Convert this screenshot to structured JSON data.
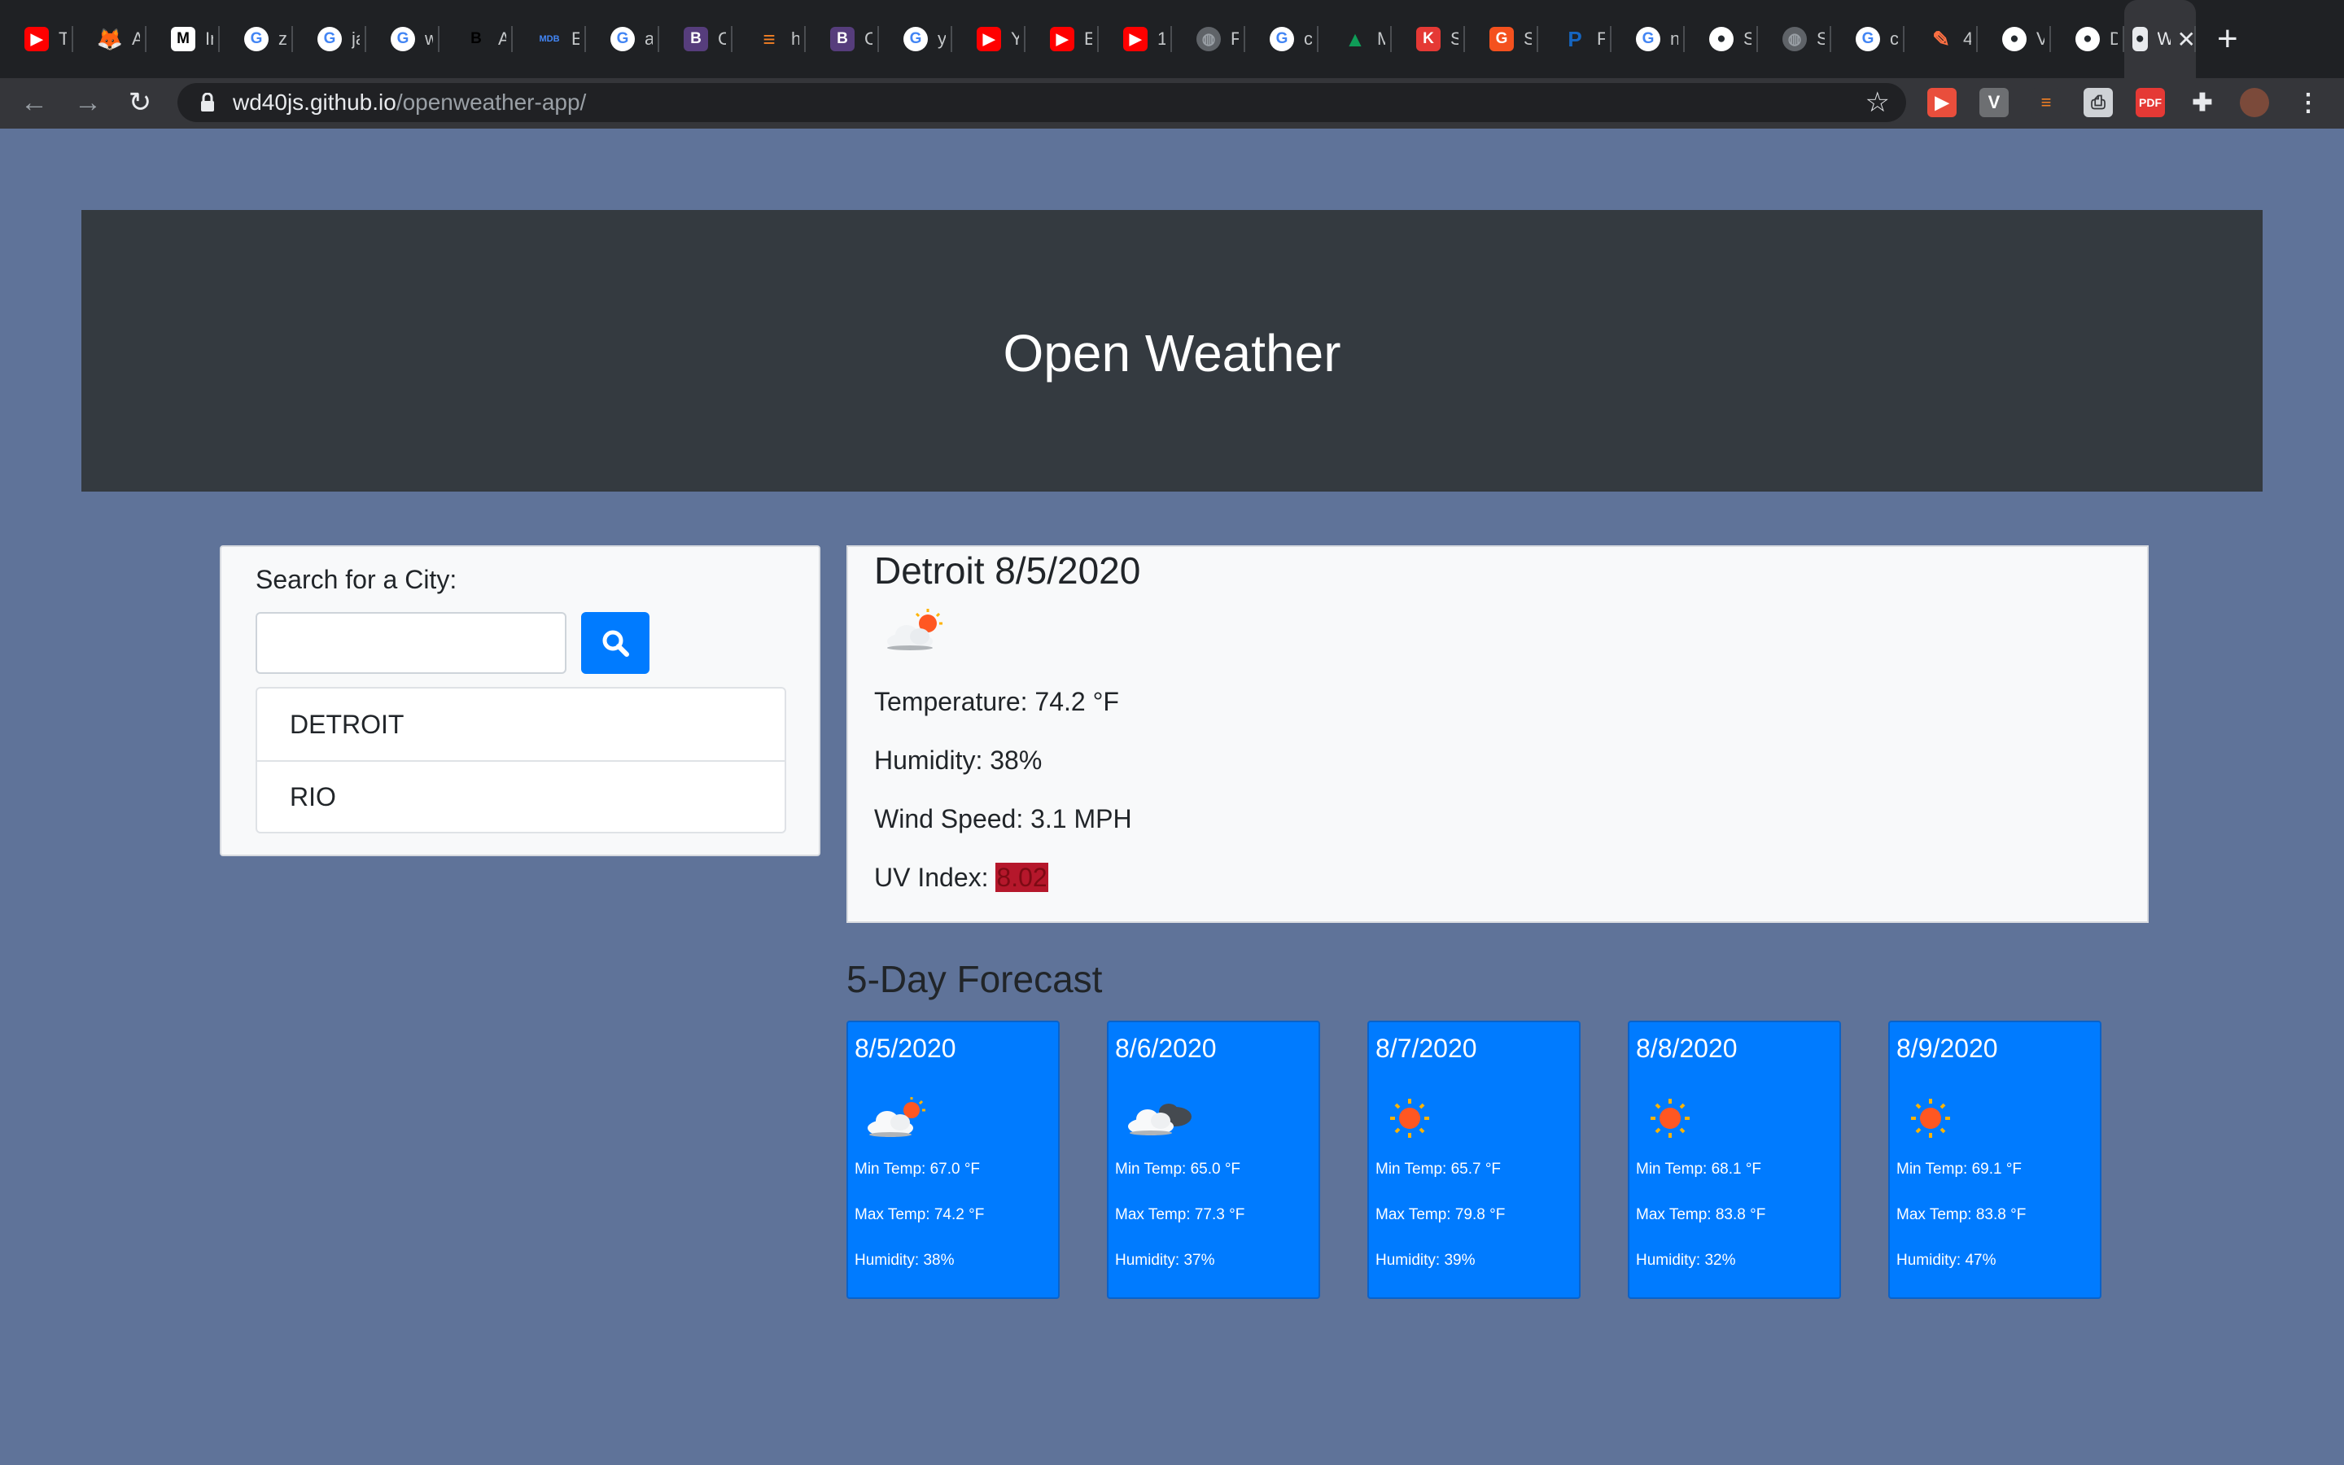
{
  "browser": {
    "tabs": [
      {
        "icon": "youtube-icon",
        "color": "#ff0000",
        "glyph": "▶",
        "text": "T"
      },
      {
        "icon": "gitlab-icon",
        "color": "#fc6d26",
        "glyph": "🦊",
        "text": "A"
      },
      {
        "icon": "medium-icon",
        "color": "#000000",
        "glyph": "M",
        "text": "Ir"
      },
      {
        "icon": "google-icon",
        "color": "#4285f4",
        "glyph": "G",
        "text": "z"
      },
      {
        "icon": "google-icon",
        "color": "#4285f4",
        "glyph": "G",
        "text": "ja"
      },
      {
        "icon": "google-icon",
        "color": "#4285f4",
        "glyph": "G",
        "text": "w"
      },
      {
        "icon": "behance-icon",
        "color": "#111111",
        "glyph": "B",
        "text": "A"
      },
      {
        "icon": "mdb-icon",
        "color": "#1c2331",
        "glyph": "MDB",
        "text": "E"
      },
      {
        "icon": "google-icon",
        "color": "#4285f4",
        "glyph": "G",
        "text": "a"
      },
      {
        "icon": "bootstrap-icon",
        "color": "#563d7c",
        "glyph": "B",
        "text": "C"
      },
      {
        "icon": "stackoverflow-icon",
        "color": "#f48024",
        "glyph": "≡",
        "text": "h"
      },
      {
        "icon": "bootstrap-icon",
        "color": "#563d7c",
        "glyph": "B",
        "text": "C"
      },
      {
        "icon": "google-icon",
        "color": "#4285f4",
        "glyph": "G",
        "text": "y"
      },
      {
        "icon": "youtube-icon",
        "color": "#ff0000",
        "glyph": "▶",
        "text": "Y"
      },
      {
        "icon": "youtube-icon",
        "color": "#ff0000",
        "glyph": "▶",
        "text": "E"
      },
      {
        "icon": "youtube-icon",
        "color": "#ff0000",
        "glyph": "▶",
        "text": "1"
      },
      {
        "icon": "globe-icon",
        "color": "#5f6368",
        "glyph": "◍",
        "text": "F"
      },
      {
        "icon": "google-icon",
        "color": "#4285f4",
        "glyph": "G",
        "text": "c"
      },
      {
        "icon": "google-drive-icon",
        "color": "#0f9d58",
        "glyph": "▲",
        "text": "M"
      },
      {
        "icon": "k-icon",
        "color": "#e53935",
        "glyph": "K",
        "text": "S"
      },
      {
        "icon": "g-orange-icon",
        "color": "#f4511e",
        "glyph": "G",
        "text": "S"
      },
      {
        "icon": "p-icon",
        "color": "#1565c0",
        "glyph": "P",
        "text": "F"
      },
      {
        "icon": "google-icon",
        "color": "#4285f4",
        "glyph": "G",
        "text": "n"
      },
      {
        "icon": "github-icon",
        "color": "#24292e",
        "glyph": "●",
        "text": "S"
      },
      {
        "icon": "globe-icon",
        "color": "#5f6368",
        "glyph": "◍",
        "text": "S"
      },
      {
        "icon": "google-icon",
        "color": "#4285f4",
        "glyph": "G",
        "text": "c"
      },
      {
        "icon": "brush-icon",
        "color": "#ff7043",
        "glyph": "✎",
        "text": "4"
      },
      {
        "icon": "github-icon",
        "color": "#24292e",
        "glyph": "●",
        "text": "V"
      },
      {
        "icon": "github-icon",
        "color": "#24292e",
        "glyph": "●",
        "text": "D"
      }
    ],
    "active_tab_text": "W",
    "url_host": "wd40js.github.io",
    "url_path": "/openweather-app/"
  },
  "header": {
    "title": "Open Weather"
  },
  "search": {
    "label": "Search for a City:",
    "input_value": "",
    "input_placeholder": "",
    "history": [
      "DETROIT",
      "RIO"
    ]
  },
  "current": {
    "title": "Detroit 8/5/2020",
    "icon": "partly-cloudy-icon",
    "temperature": "Temperature: 74.2 °F",
    "humidity": "Humidity: 38%",
    "wind": "Wind Speed: 3.1 MPH",
    "uv_label": "UV Index:",
    "uv_value": "8.02",
    "uv_color": "#b5172b"
  },
  "forecast": {
    "title": "5-Day Forecast",
    "days": [
      {
        "date": "8/5/2020",
        "icon": "partly-cloudy-icon",
        "min": "Min Temp: 67.0 °F",
        "max": "Max Temp: 74.2 °F",
        "humidity": "Humidity: 38%"
      },
      {
        "date": "8/6/2020",
        "icon": "cloudy-icon",
        "min": "Min Temp: 65.0 °F",
        "max": "Max Temp: 77.3 °F",
        "humidity": "Humidity: 37%"
      },
      {
        "date": "8/7/2020",
        "icon": "sun-icon",
        "min": "Min Temp: 65.7 °F",
        "max": "Max Temp: 79.8 °F",
        "humidity": "Humidity: 39%"
      },
      {
        "date": "8/8/2020",
        "icon": "sun-icon",
        "min": "Min Temp: 68.1 °F",
        "max": "Max Temp: 83.8 °F",
        "humidity": "Humidity: 32%"
      },
      {
        "date": "8/9/2020",
        "icon": "sun-icon",
        "min": "Min Temp: 69.1 °F",
        "max": "Max Temp: 83.8 °F",
        "humidity": "Humidity: 47%"
      }
    ]
  },
  "colors": {
    "page_bg": "#5f7399",
    "header_bg": "#343a40",
    "primary": "#007bff"
  }
}
